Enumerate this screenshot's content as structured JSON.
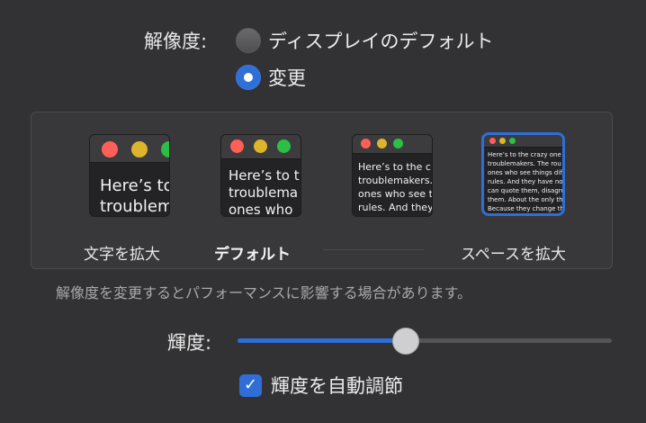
{
  "resolution": {
    "label": "解像度:",
    "options": [
      {
        "label": "ディスプレイのデフォルト",
        "selected": false
      },
      {
        "label": "変更",
        "selected": true
      }
    ]
  },
  "scaling": {
    "preview_text": [
      "Here’s to\ntroublem",
      "Here’s to t\ntroublema\nones who",
      "Here’s to the cr\ntroublemakers.\nones who see t\nrules. And they",
      "Here’s to the crazy one\ntroublemakers. The rou\nones who see things diff\nrules. And they have no\ncan quote them, disagre\nthem. About the only th\nBecause they change th"
    ],
    "labels": {
      "larger_text": "文字を拡大",
      "default": "デフォルト",
      "more_space": "スペースを拡大"
    },
    "selected_index": 3,
    "note": "解像度を変更するとパフォーマンスに影響する場合があります。"
  },
  "brightness": {
    "label": "輝度:",
    "value_percent": 45,
    "auto_label": "輝度を自動調節",
    "auto_checked": true,
    "check_glyph": "✓"
  },
  "colors": {
    "accent": "#2e6ed6",
    "background": "#323234"
  }
}
